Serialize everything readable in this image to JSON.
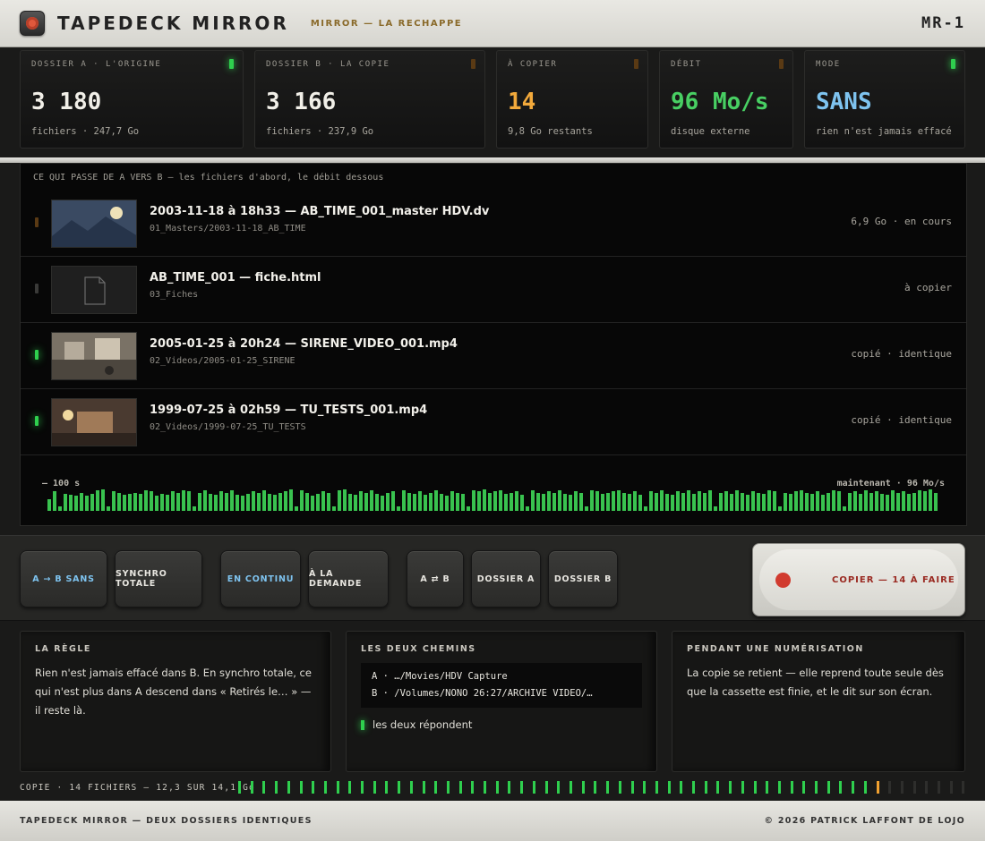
{
  "header": {
    "title": "TAPEDECK MIRROR",
    "subtitle": "MIRROR — LA RECHAPPE",
    "model": "MR-1"
  },
  "stats": [
    {
      "label": "DOSSIER A · L'ORIGINE",
      "value": "3 180",
      "sub": "fichiers · 247,7 Go",
      "led": "on",
      "color": "#f1efe8"
    },
    {
      "label": "DOSSIER B · LA COPIE",
      "value": "3 166",
      "sub": "fichiers · 237,9 Go",
      "led": "dim",
      "color": "#f1efe8"
    },
    {
      "label": "À COPIER",
      "value": "14",
      "sub": "9,8 Go restants",
      "led": "dim",
      "color": "#f2a93b"
    },
    {
      "label": "DÉBIT",
      "value": "96 Mo/s",
      "sub": "disque externe",
      "led": "dim",
      "color": "#48cf63"
    },
    {
      "label": "MODE",
      "value": "SANS",
      "sub": "rien n'est jamais effacé",
      "led": "on",
      "color": "#7ec3ef"
    }
  ],
  "transfer": {
    "heading": "CE QUI PASSE DE A VERS B — les fichiers d'abord, le débit dessous",
    "files": [
      {
        "name": "2003-11-18 à 18h33 — AB_TIME_001_master HDV.dv",
        "path": "01_Masters/2003-11-18_AB_TIME",
        "status": "6,9 Go · en cours",
        "led": "amber",
        "thumb": "landscape-thumbnail"
      },
      {
        "name": "AB_TIME_001 — fiche.html",
        "path": "03_Fiches",
        "status": "à copier",
        "led": "gray",
        "thumb": "document-icon"
      },
      {
        "name": "2005-01-25 à 20h24 — SIRENE_VIDEO_001.mp4",
        "path": "02_Videos/2005-01-25_SIRENE",
        "status": "copié · identique",
        "led": "green",
        "thumb": "room-thumbnail"
      },
      {
        "name": "1999-07-25 à 02h59 — TU_TESTS_001.mp4",
        "path": "02_Videos/1999-07-25_TU_TESTS",
        "status": "copié · identique",
        "led": "green",
        "thumb": "interior-thumbnail"
      }
    ],
    "meter_left": "— 100 s",
    "meter_right": "maintenant · 96 Mo/s",
    "meter_levels": [
      0.55,
      0.9,
      0.2,
      0.8,
      0.75,
      0.7,
      0.85,
      0.7,
      0.8,
      0.95,
      1.0,
      0.2,
      0.9,
      0.85,
      0.75,
      0.8,
      0.85,
      0.8,
      0.95,
      0.9,
      0.7,
      0.8,
      0.75,
      0.9,
      0.85,
      0.95,
      0.9,
      0.2,
      0.85,
      0.95,
      0.8,
      0.75,
      0.9,
      0.85,
      0.95,
      0.75,
      0.7,
      0.8,
      0.9,
      0.85,
      0.95,
      0.8,
      0.75,
      0.85,
      0.9,
      1.0,
      0.2,
      0.95,
      0.85,
      0.7,
      0.8,
      0.9,
      0.85,
      0.2,
      0.95,
      1.0,
      0.8,
      0.75,
      0.9,
      0.85,
      0.95,
      0.8,
      0.7,
      0.85,
      0.9,
      0.2,
      0.95,
      0.85,
      0.8,
      0.9,
      0.75,
      0.85,
      0.95,
      0.8,
      0.7,
      0.9,
      0.85,
      0.8,
      0.2,
      0.95,
      0.9,
      1.0,
      0.85,
      0.9,
      0.95,
      0.8,
      0.85,
      0.9,
      0.75,
      0.2,
      0.95,
      0.85,
      0.8,
      0.9,
      0.85,
      0.95,
      0.8,
      0.75,
      0.9,
      0.85,
      0.2,
      0.95,
      0.9,
      0.8,
      0.85,
      0.9,
      0.95,
      0.85,
      0.8,
      0.9,
      0.75,
      0.2,
      0.9,
      0.85,
      0.95,
      0.8,
      0.75,
      0.9,
      0.85,
      0.95,
      0.8,
      0.9,
      0.85,
      0.95,
      0.2,
      0.85,
      0.9,
      0.8,
      0.95,
      0.85,
      0.75,
      0.9,
      0.85,
      0.8,
      0.95,
      0.9,
      0.2,
      0.85,
      0.8,
      0.9,
      0.95,
      0.85,
      0.8,
      0.9,
      0.75,
      0.85,
      0.95,
      0.9,
      0.2,
      0.85,
      0.9,
      0.8,
      0.95,
      0.85,
      0.9,
      0.8,
      0.75,
      0.95,
      0.85,
      0.9,
      0.8,
      0.85,
      0.95,
      0.9,
      1.0,
      0.85
    ]
  },
  "controls": {
    "buttons": [
      {
        "label": "A → B SANS",
        "active": true
      },
      {
        "label": "SYNCHRO TOTALE",
        "active": false
      },
      {
        "label": "EN CONTINU",
        "active": true
      },
      {
        "label": "À LA DEMANDE",
        "active": false
      },
      {
        "label": "A ⇄ B",
        "active": false
      },
      {
        "label": "DOSSIER A",
        "active": false
      },
      {
        "label": "DOSSIER B",
        "active": false
      }
    ],
    "copy_label": "COPIER — 14 À FAIRE"
  },
  "panels": {
    "rule": {
      "title": "LA RÈGLE",
      "text": "Rien n'est jamais effacé dans B. En synchro totale, ce qui n'est plus dans A descend dans « Retirés le… » — il reste là."
    },
    "paths": {
      "title": "LES DEUX CHEMINS",
      "a": "A · …/Movies/HDV Capture",
      "b": "B · /Volumes/NONO 26:27/ARCHIVE VIDEO/…",
      "ok": "les deux répondent"
    },
    "scan": {
      "title": "PENDANT UNE NUMÉRISATION",
      "text": "La copie se retient — elle reprend toute seule dès que la cassette est finie, et le dit sur son écran."
    }
  },
  "progress": {
    "label": "COPIE · 14 FICHIERS — 12,3 SUR 14,1 Go",
    "done_ticks": 52,
    "total_ticks": 60
  },
  "footer": {
    "left": "TAPEDECK MIRROR — DEUX DOSSIERS IDENTIQUES",
    "right": "© 2026 PATRICK LAFFONT DE LOJO"
  }
}
